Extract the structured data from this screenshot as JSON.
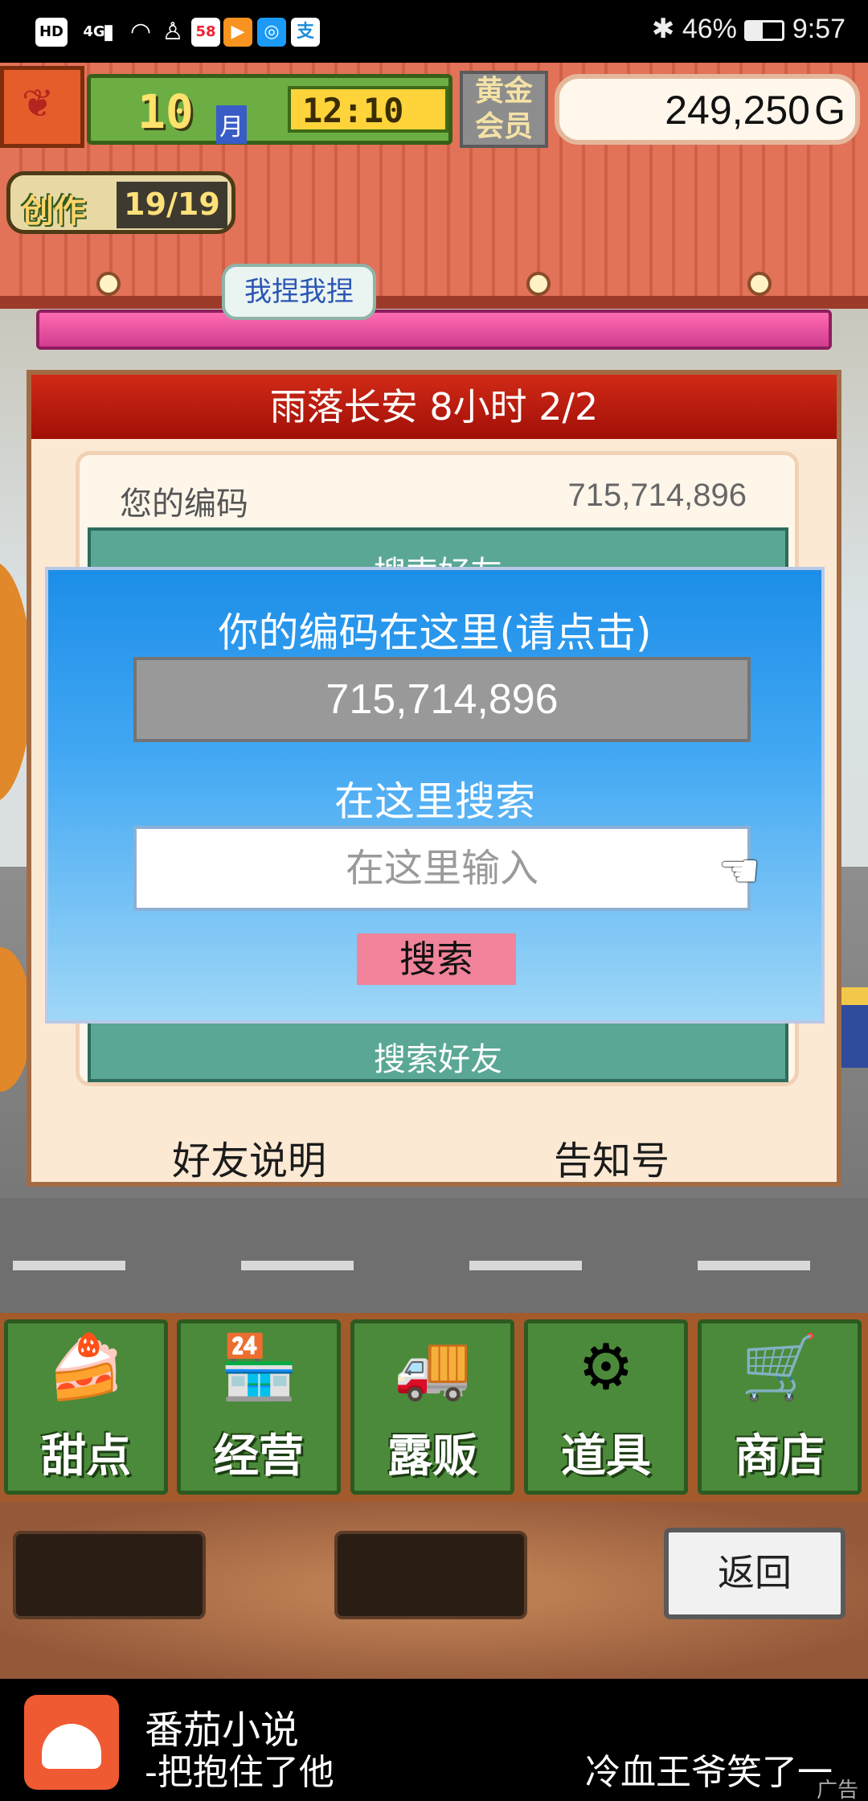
{
  "status_bar": {
    "left_icons": [
      "HD",
      "4G",
      "signal-icon",
      "wifi-icon",
      "notification-icon",
      "58",
      "video-app-icon",
      "browser-icon",
      "alipay-icon"
    ],
    "battery": "46%",
    "time": "9:57"
  },
  "hud": {
    "month": "10",
    "month_unit": "月",
    "clock": "12:10",
    "membership": "黄金会员",
    "money": "249,250",
    "money_unit": "G",
    "create_label": "创作",
    "create_count": "19/19",
    "speech_bubble": "我捏我捏"
  },
  "panel": {
    "title": "雨落长安  8小时 2/2",
    "code_label": "您的编码",
    "code_value": "715,714,896",
    "search_friend_top": "搜索好友",
    "search_friend": "搜索好友",
    "friend_help": "好友说明",
    "notice": "告知号"
  },
  "dialog": {
    "title": "你的编码在这里(请点击)",
    "code": "715,714,896",
    "search_heading": "在这里搜索",
    "search_placeholder": "在这里输入",
    "search_button": "搜索"
  },
  "menu": [
    {
      "label": "甜点",
      "icon": "cake-icon"
    },
    {
      "label": "经营",
      "icon": "shop-building-icon"
    },
    {
      "label": "露贩",
      "icon": "food-truck-icon"
    },
    {
      "label": "道具",
      "icon": "gear-bag-icon"
    },
    {
      "label": "商店",
      "icon": "shopping-cart-icon"
    }
  ],
  "bottom": {
    "back_button": "返回"
  },
  "ad": {
    "app_name": "番茄小说",
    "subtitle": "-把抱住了他",
    "right_text": "冷血王爷笑了一",
    "tag": "广告"
  }
}
